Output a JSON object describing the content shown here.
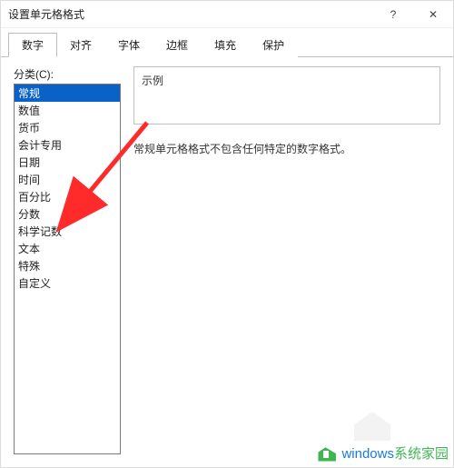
{
  "window": {
    "title": "设置单元格格式",
    "help_glyph": "?",
    "close_glyph": "✕"
  },
  "tabs": [
    {
      "label": "数字",
      "active": true
    },
    {
      "label": "对齐",
      "active": false
    },
    {
      "label": "字体",
      "active": false
    },
    {
      "label": "边框",
      "active": false
    },
    {
      "label": "填充",
      "active": false
    },
    {
      "label": "保护",
      "active": false
    }
  ],
  "category_label": "分类(C):",
  "categories": [
    {
      "label": "常规",
      "selected": true
    },
    {
      "label": "数值",
      "selected": false
    },
    {
      "label": "货币",
      "selected": false
    },
    {
      "label": "会计专用",
      "selected": false
    },
    {
      "label": "日期",
      "selected": false
    },
    {
      "label": "时间",
      "selected": false
    },
    {
      "label": "百分比",
      "selected": false
    },
    {
      "label": "分数",
      "selected": false
    },
    {
      "label": "科学记数",
      "selected": false
    },
    {
      "label": "文本",
      "selected": false
    },
    {
      "label": "特殊",
      "selected": false
    },
    {
      "label": "自定义",
      "selected": false
    }
  ],
  "sample": {
    "label": "示例",
    "value": ""
  },
  "description": "常规单元格格式不包含任何特定的数字格式。",
  "annotation": {
    "arrow_color": "#ff2a2a",
    "points_to": "文本"
  },
  "watermark": {
    "brand_part1": "windows",
    "brand_part2": "系统家园"
  }
}
